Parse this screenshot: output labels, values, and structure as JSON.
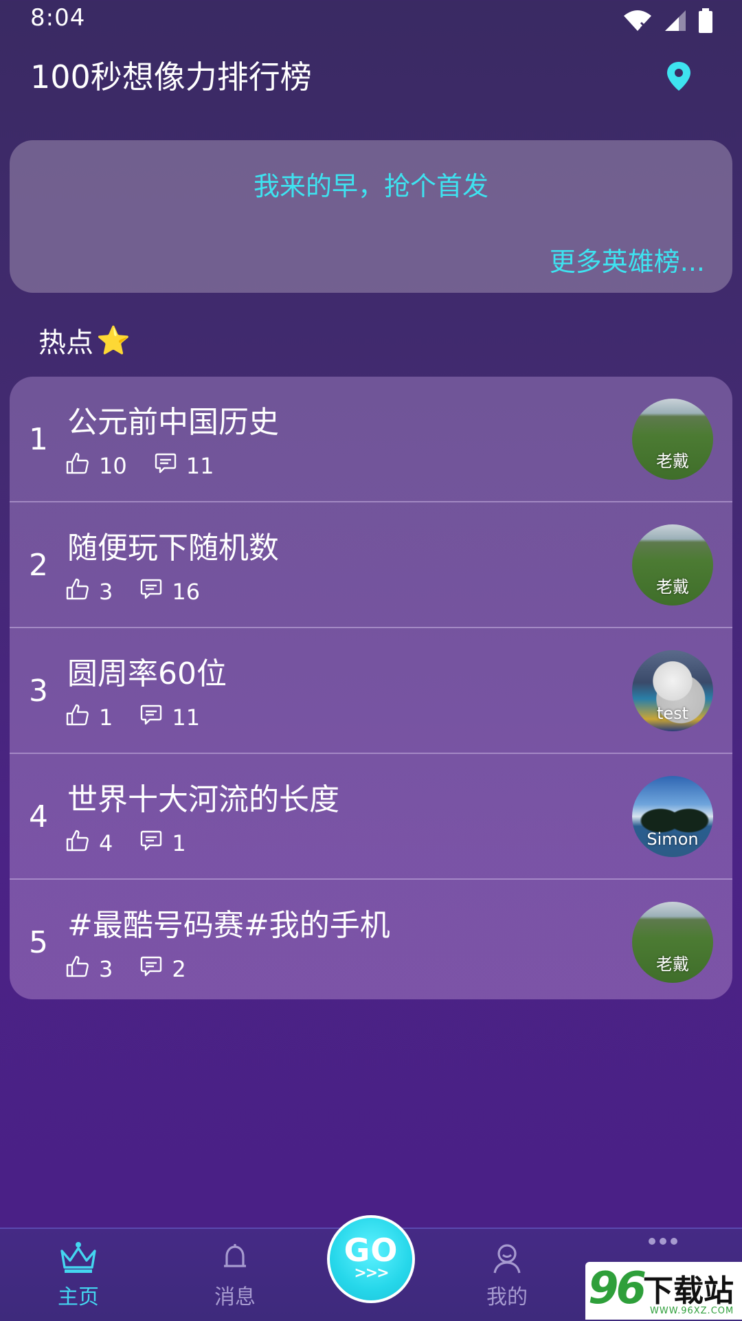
{
  "status_bar": {
    "time": "8:04"
  },
  "header": {
    "title": "100秒想像力排行榜",
    "location_icon": "location-pin-icon",
    "accent_color": "#3ee3f0"
  },
  "announcement": {
    "text": "我来的早，抢个首发",
    "more_link": "更多英雄榜..."
  },
  "section": {
    "title": "热点",
    "emoji": "⭐"
  },
  "hot_list": [
    {
      "rank": "1",
      "title": "公元前中国历史",
      "likes": "10",
      "comments": "11",
      "author": "老戴",
      "avatar": "field"
    },
    {
      "rank": "2",
      "title": "随便玩下随机数",
      "likes": "3",
      "comments": "16",
      "author": "老戴",
      "avatar": "field"
    },
    {
      "rank": "3",
      "title": "圆周率60位",
      "likes": "1",
      "comments": "11",
      "author": "test",
      "avatar": "cat"
    },
    {
      "rank": "4",
      "title": "世界十大河流的长度",
      "likes": "4",
      "comments": "1",
      "author": "Simon",
      "avatar": "sky"
    },
    {
      "rank": "5",
      "title": "#最酷号码赛#我的手机",
      "likes": "3",
      "comments": "2",
      "author": "老戴",
      "avatar": "field"
    }
  ],
  "bottom_nav": {
    "home": "主页",
    "messages": "消息",
    "go": "GO",
    "go_arrows": ">>>",
    "mine": "我的"
  },
  "watermark": {
    "number": "96",
    "text": "下载站",
    "url": "WWW.96XZ.COM"
  }
}
